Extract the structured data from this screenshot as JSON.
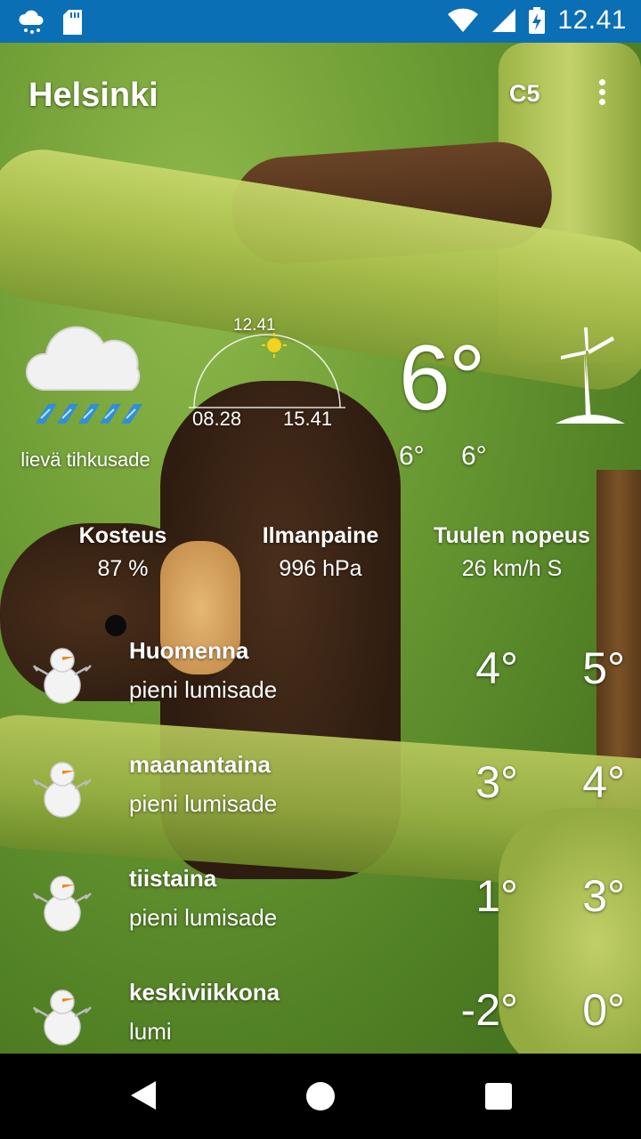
{
  "status_bar": {
    "time": "12.41",
    "icons": [
      "weather-snow-icon",
      "sd-card-icon",
      "wifi-icon",
      "signal-icon",
      "battery-charging-icon"
    ]
  },
  "header": {
    "city": "Helsinki",
    "unit_button": "C5",
    "menu_icon": "more-vert-icon"
  },
  "current": {
    "condition_icon": "cloud-drizzle-icon",
    "condition": "lievä tihkusade",
    "sun": {
      "now": "12.41",
      "sunrise": "08.28",
      "sunset": "15.41"
    },
    "temperature": "6°",
    "min": "6°",
    "max": "6°",
    "wind_icon": "wind-turbine-icon"
  },
  "stats": [
    {
      "label": "Kosteus",
      "value": "87 %"
    },
    {
      "label": "Ilmanpaine",
      "value": "996 hPa"
    },
    {
      "label": "Tuulen nopeus",
      "value": "26 km/h S"
    }
  ],
  "forecast": [
    {
      "day": "Huomenna",
      "desc": "pieni lumisade",
      "lo": "4°",
      "hi": "5°",
      "icon": "snowman-icon"
    },
    {
      "day": "maanantaina",
      "desc": "pieni lumisade",
      "lo": "3°",
      "hi": "4°",
      "icon": "snowman-icon"
    },
    {
      "day": "tiistaina",
      "desc": "pieni lumisade",
      "lo": "1°",
      "hi": "3°",
      "icon": "snowman-icon"
    },
    {
      "day": "keskiviikkona",
      "desc": "lumi",
      "lo": "-2°",
      "hi": "0°",
      "icon": "snowman-icon"
    }
  ],
  "colors": {
    "status_bar": "#0a6fb5",
    "nav_bar": "#000000",
    "rain": "#2f8fd8"
  }
}
